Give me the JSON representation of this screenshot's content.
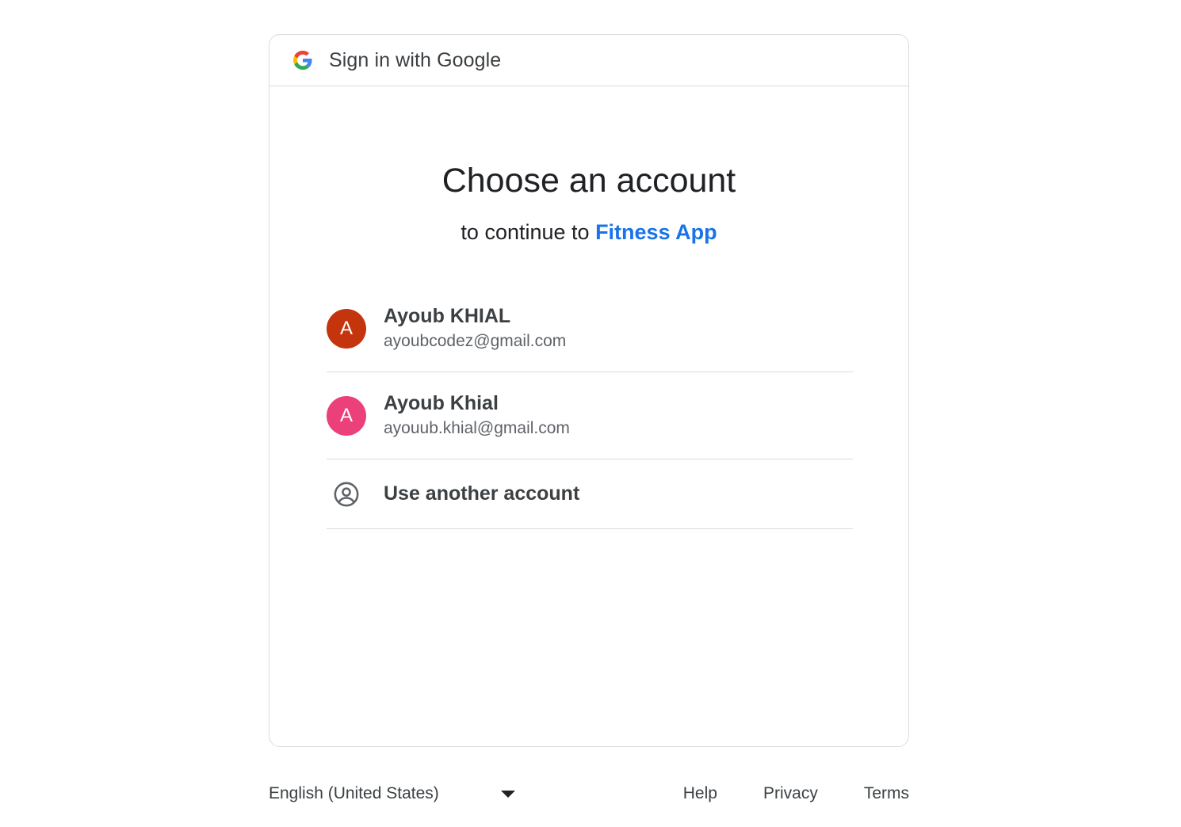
{
  "header": {
    "title": "Sign in with Google",
    "logo_icon": "google-g-icon"
  },
  "main": {
    "heading": "Choose an account",
    "subheading_prefix": "to continue to",
    "app_name": "Fitness App",
    "app_color": "#1a73e8"
  },
  "accounts": [
    {
      "name": "Ayoub KHIAL",
      "email": "ayoubcodez@gmail.com",
      "initial": "A",
      "avatar_color": "#c5350d"
    },
    {
      "name": "Ayoub Khial",
      "email": "ayouub.khial@gmail.com",
      "initial": "A",
      "avatar_color": "#ec407a"
    }
  ],
  "other_account": {
    "label": "Use another account",
    "icon": "account-circle-icon"
  },
  "footer": {
    "language": "English (United States)",
    "links": {
      "help": "Help",
      "privacy": "Privacy",
      "terms": "Terms"
    }
  }
}
